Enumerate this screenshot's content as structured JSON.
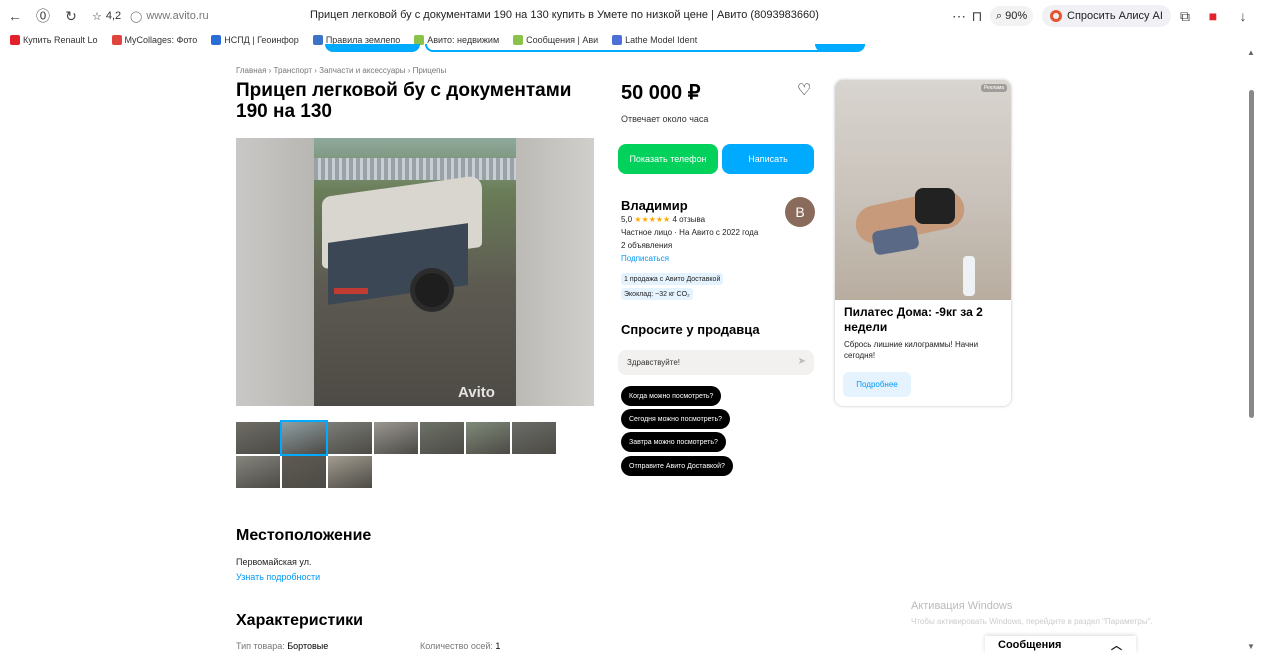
{
  "browser": {
    "rating": "4,2",
    "url": "www.avito.ru",
    "tab_title": "Прицеп легковой бу с документами 190 на 130 купить в Умете по низкой цене | Авито (8093983660)",
    "zoom": "90%",
    "alice_label": "Спросить Алису AI",
    "bookmarks": [
      {
        "label": "Купить Renault Lo",
        "icon": "avito-icon",
        "color": "#e4202a"
      },
      {
        "label": "MyCollages: Фото",
        "icon": "collage-icon",
        "color": "#e0443c"
      },
      {
        "label": "НСПД | Геоинфор",
        "icon": "map-icon",
        "color": "#2a6fd6"
      },
      {
        "label": "Правила землепо",
        "icon": "book-icon",
        "color": "#3c73c9"
      },
      {
        "label": "Авито: недвижим",
        "icon": "avito-dots-icon",
        "color": "#8bc34a"
      },
      {
        "label": "Сообщения | Ави",
        "icon": "avito-dots-icon",
        "color": "#8bc34a"
      },
      {
        "label": "Lathe Model Ident",
        "icon": "lathe-icon",
        "color": "#4a6fd6"
      }
    ]
  },
  "listing": {
    "breadcrumb": "Главная › Транспорт › Запчасти и аксессуары › Прицепы",
    "title": "Прицеп легковой бу с документами 190 на 130",
    "watermark": "Avito",
    "thumb_count": 10,
    "price": "50 000 ₽",
    "reply_time": "Отвечает около часа",
    "btn_phone": "Показать телефон",
    "btn_write": "Написать"
  },
  "seller": {
    "name": "Владимир",
    "avatar_letter": "В",
    "rating": "5,0",
    "stars": "★★★★★",
    "reviews": "4 отзыва",
    "type_since": "Частное лицо · На Авито с 2022 года",
    "ads_count": "2 объявления",
    "subscribe": "Подписаться",
    "badge1": "1 продажа с Авито Доставкой",
    "badge2": "Экоклад: ~32 кг CO₂"
  },
  "ask": {
    "title": "Спросите у продавца",
    "input_value": "Здравствуйте!",
    "chips": [
      "Когда можно посмотреть?",
      "Сегодня можно посмотреть?",
      "Завтра можно посмотреть?",
      "Отправите Авито Доставкой?"
    ]
  },
  "ad": {
    "label": "Реклама",
    "title": "Пилатес Дома: -9кг за 2 недели",
    "desc": "Сбрось лишние килограммы! Начни сегодня!",
    "button": "Подробнее"
  },
  "location": {
    "heading": "Местоположение",
    "street": "Первомайская ул.",
    "link": "Узнать подробности"
  },
  "specs": {
    "heading": "Характеристики",
    "type_label": "Тип товара:",
    "type_value": "Бортовые",
    "axles_label": "Количество осей:",
    "axles_value": "1"
  },
  "os": {
    "activation_title": "Активация Windows",
    "activation_text": "Чтобы активировать Windows, перейдите в раздел \"Параметры\"."
  },
  "messages": {
    "label": "Сообщения"
  }
}
